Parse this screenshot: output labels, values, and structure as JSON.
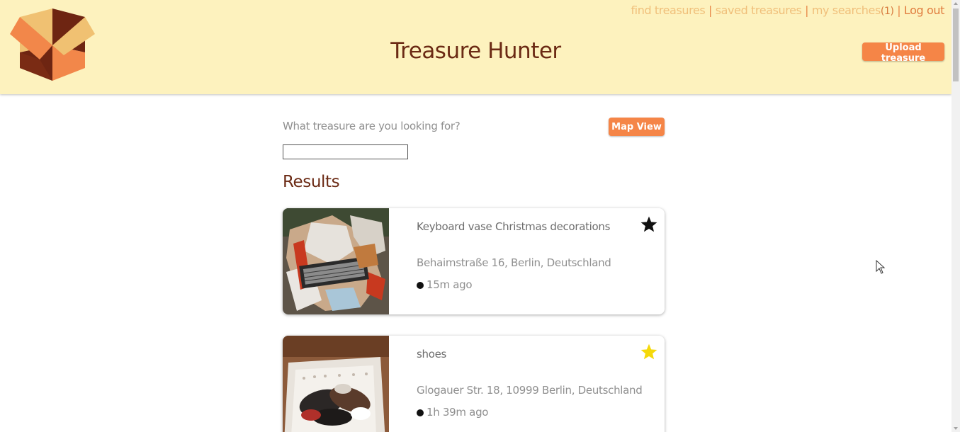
{
  "header": {
    "title": "Treasure Hunter",
    "logo_icon": "open-box-icon",
    "nav": {
      "find": "find treasures",
      "saved": "saved treasures",
      "searches": "my searches",
      "searches_count": "(1)",
      "separator": "|",
      "logout": "Log out"
    },
    "upload_label": "Upload treasure"
  },
  "search": {
    "label": "What treasure are you looking for?",
    "value": "",
    "map_view_label": "Map View"
  },
  "results": {
    "heading": "Results",
    "items": [
      {
        "title": "Keyboard vase Christmas decorations",
        "address": "Behaimstraße 16, Berlin, Deutschland",
        "time": "15m ago",
        "saved": true,
        "star_color": "#111111",
        "image_icon": "keyboard-photo"
      },
      {
        "title": "shoes",
        "address": "Glogauer Str. 18, 10999 Berlin, Deutschland",
        "time": "1h 39m ago",
        "saved": false,
        "star_color": "#f5d90a",
        "image_icon": "shoes-photo"
      }
    ]
  },
  "colors": {
    "header_bg": "#fdf2be",
    "title": "#6b2a14",
    "accent_button": "#f58547",
    "nav_link": "#f0bf7a"
  }
}
